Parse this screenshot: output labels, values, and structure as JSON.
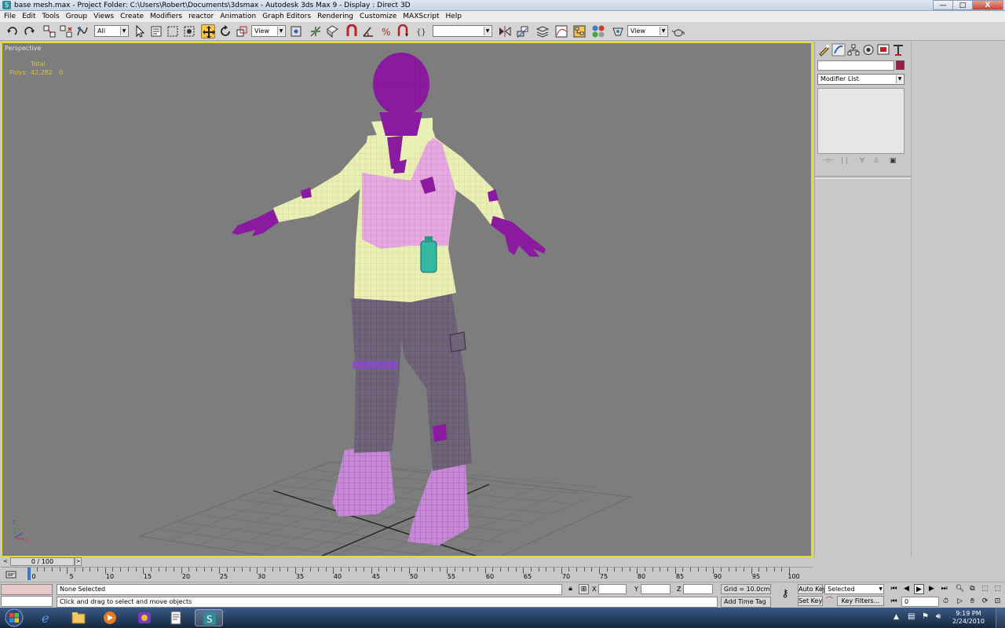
{
  "window": {
    "title": "base mesh.max    - Project Folder: C:\\Users\\Robert\\Documents\\3dsmax    - Autodesk 3ds Max 9    - Display : Direct 3D",
    "app_icon": "3ds-max-icon",
    "controls": {
      "minimize": "—",
      "maximize": "□",
      "close": "X"
    }
  },
  "menubar": {
    "items": [
      "File",
      "Edit",
      "Tools",
      "Group",
      "Views",
      "Create",
      "Modifiers",
      "reactor",
      "Animation",
      "Graph Editors",
      "Rendering",
      "Customize",
      "MAXScript",
      "Help"
    ]
  },
  "toolbar": {
    "selection_filter": "All",
    "ref_coord_1": "View",
    "named_selection": "",
    "ref_coord_2": "View",
    "active_tool": "select-and-move"
  },
  "viewport": {
    "label": "Perspective",
    "stats_header": "Total",
    "stats_label": "Polys:",
    "stats_value": "42,282",
    "stats_selected": "0",
    "axis_labels": {
      "z": "z",
      "x": "x"
    }
  },
  "command_panel": {
    "tabs": [
      "create",
      "modify",
      "hierarchy",
      "motion",
      "display",
      "utilities"
    ],
    "object_name": "",
    "object_color": "#991c4a",
    "modifier_list": "Modifier List"
  },
  "time_slider": {
    "value": "0 / 100"
  },
  "track": {
    "labels": [
      "0",
      "5",
      "10",
      "15",
      "20",
      "25",
      "30",
      "35",
      "40",
      "45",
      "50",
      "55",
      "60",
      "65",
      "70",
      "75",
      "80",
      "85",
      "90",
      "95",
      "100"
    ]
  },
  "status": {
    "selection": "None Selected",
    "prompt": "Click and drag to select and move objects",
    "x_label": "X",
    "y_label": "Y",
    "z_label": "Z",
    "x_value": "",
    "y_value": "",
    "z_value": "",
    "grid": "Grid = 10.0cm",
    "add_time_tag": "Add Time Tag",
    "auto_key": "Auto Key",
    "set_key": "Set Key",
    "key_mode": "Selected",
    "key_filters": "Key Filters...",
    "frame": "0"
  },
  "taskbar": {
    "time": "9:19 PM",
    "date": "2/24/2010",
    "apps": [
      "ie-icon",
      "explorer-icon",
      "media-player-icon",
      "messenger-icon",
      "notepad-icon",
      "3ds-max-icon"
    ]
  }
}
